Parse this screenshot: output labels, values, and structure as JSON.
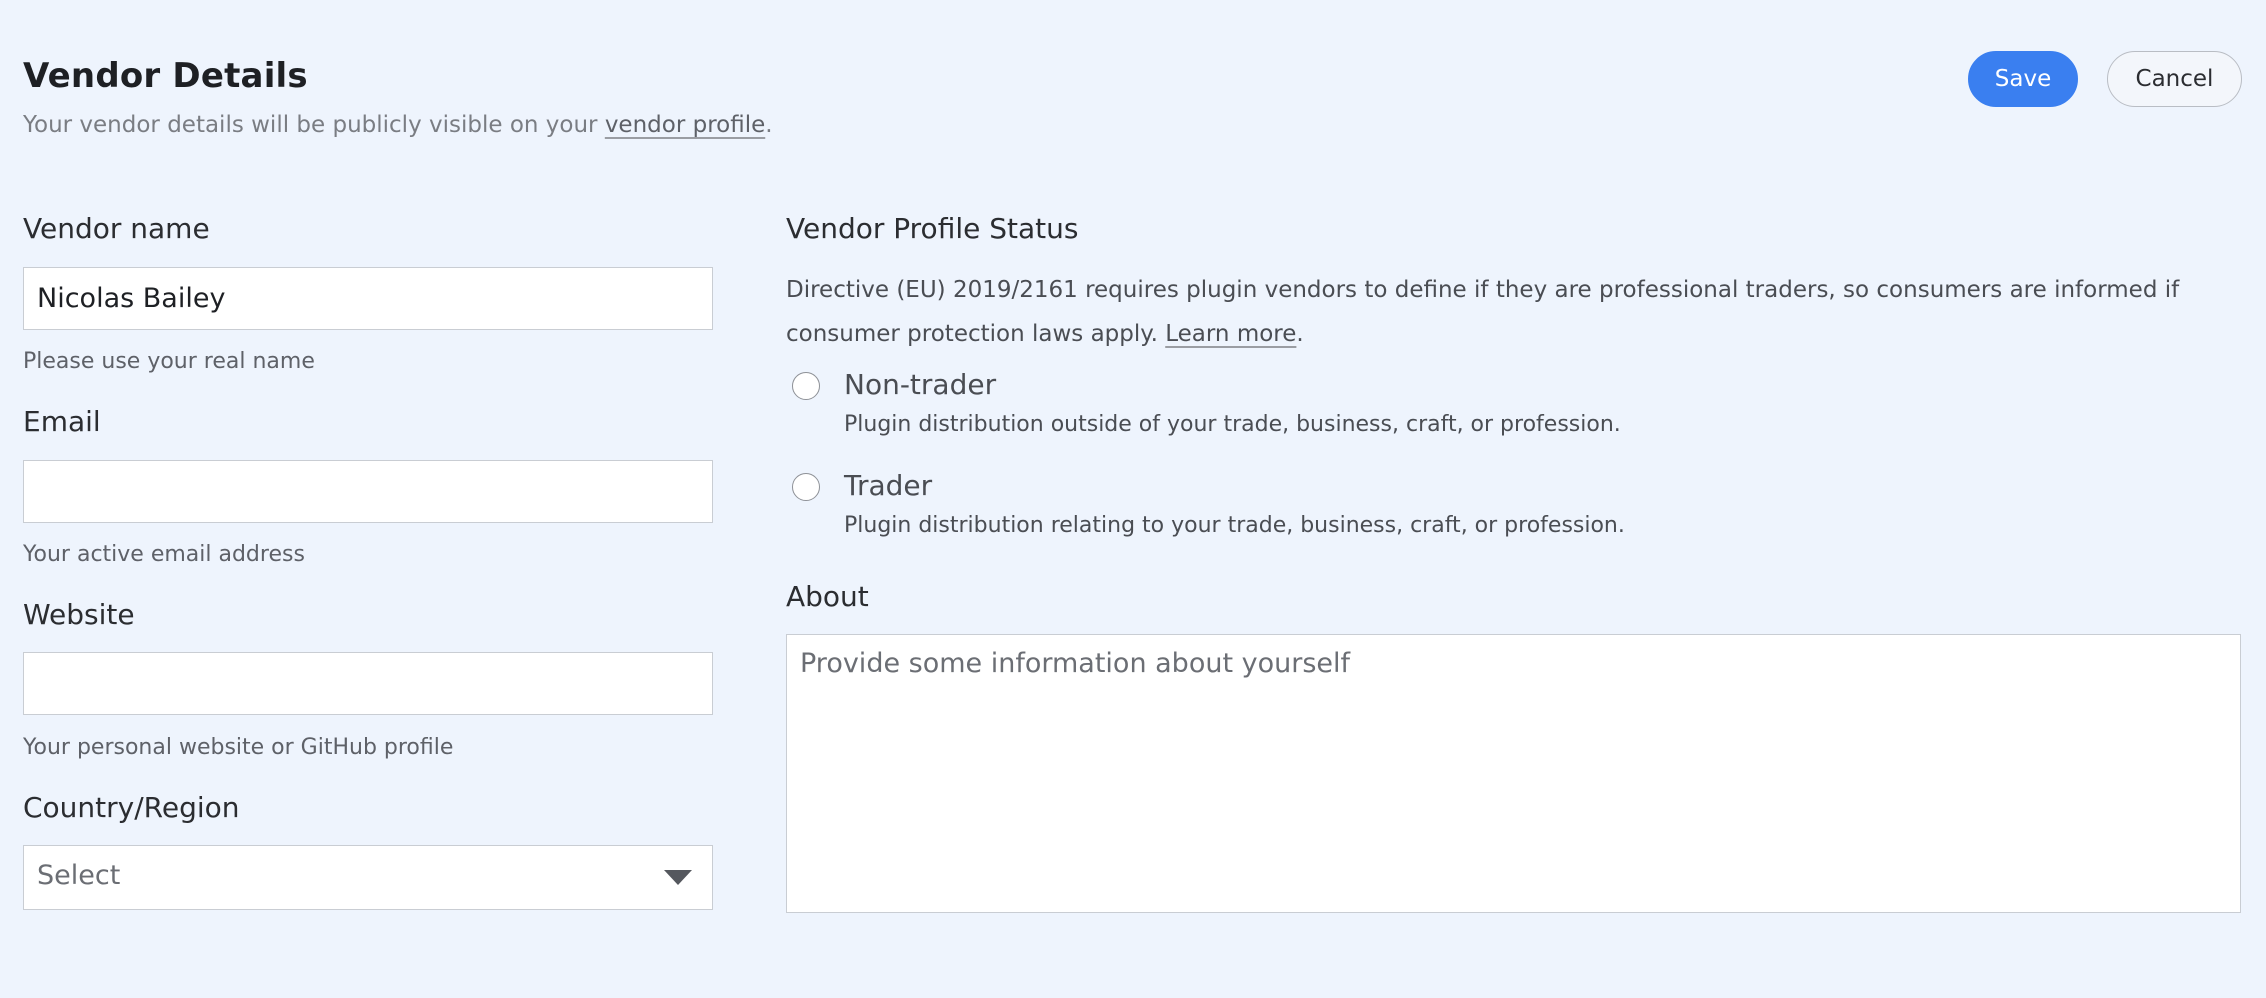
{
  "header": {
    "title": "Vendor Details",
    "subtitle_prefix": "Your vendor details will be publicly visible on your ",
    "subtitle_link": "vendor profile",
    "subtitle_suffix": "."
  },
  "actions": {
    "save_label": "Save",
    "cancel_label": "Cancel",
    "save_color": "#3a7ff0"
  },
  "form": {
    "vendor_name": {
      "label": "Vendor name",
      "value": "Nicolas Bailey",
      "help": "Please use your real name"
    },
    "email": {
      "label": "Email",
      "value": "",
      "help": "Your active email address"
    },
    "website": {
      "label": "Website",
      "value": "",
      "help": "Your personal website or GitHub profile"
    },
    "country": {
      "label": "Country/Region",
      "selected": "Select"
    }
  },
  "profile_status": {
    "title": "Vendor Profile Status",
    "description": "Directive (EU) 2019/2161 requires plugin vendors to define if they are professional traders, so consumers are informed if consumer protection laws apply. ",
    "learn_more": "Learn more",
    "description_suffix": ".",
    "options": [
      {
        "label": "Non-trader",
        "description": "Plugin distribution outside of your trade, business, craft, or profession.",
        "selected": false
      },
      {
        "label": "Trader",
        "description": "Plugin distribution relating to your trade, business, craft, or profession.",
        "selected": false
      }
    ]
  },
  "about": {
    "label": "About",
    "placeholder": "Provide some information about yourself",
    "value": ""
  }
}
